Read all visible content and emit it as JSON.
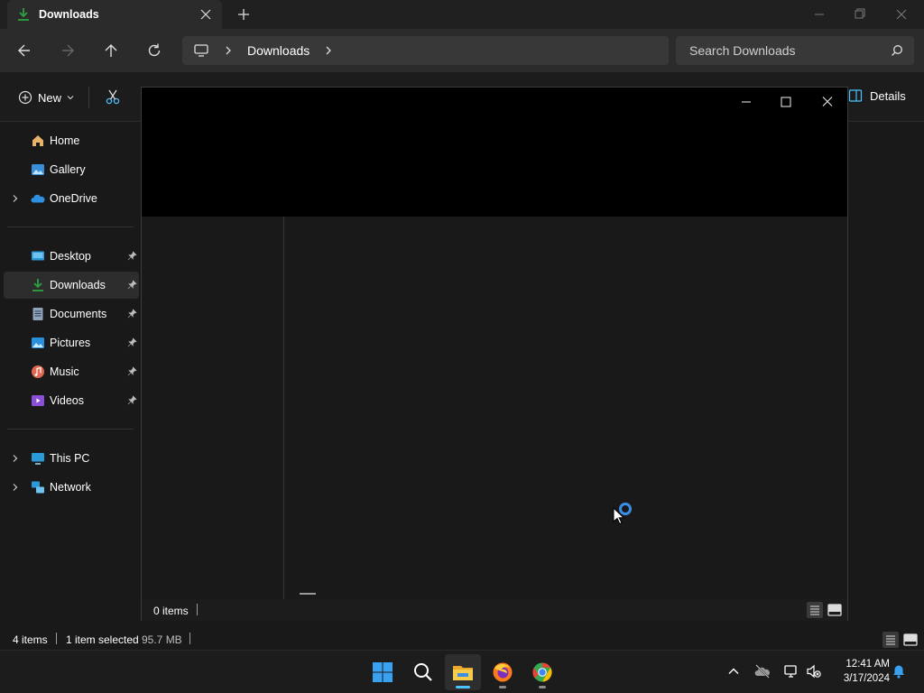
{
  "window": {
    "tab_title": "Downloads",
    "colors": {
      "accent": "#4cc2ff",
      "download_green": "#2ea043",
      "background": "#191919"
    }
  },
  "navbar": {
    "breadcrumb": "Downloads",
    "search_placeholder": "Search Downloads"
  },
  "command_bar": {
    "new_label": "New",
    "details_label": "Details"
  },
  "sidebar": {
    "items": [
      {
        "label": "Home",
        "icon": "home-icon",
        "expandable": false
      },
      {
        "label": "Gallery",
        "icon": "gallery-icon",
        "expandable": false
      },
      {
        "label": "OneDrive",
        "icon": "onedrive-icon",
        "expandable": true
      },
      {
        "label": "Desktop",
        "icon": "desktop-icon",
        "pinned": true
      },
      {
        "label": "Downloads",
        "icon": "downloads-icon",
        "pinned": true,
        "selected": true
      },
      {
        "label": "Documents",
        "icon": "documents-icon",
        "pinned": true
      },
      {
        "label": "Pictures",
        "icon": "pictures-icon",
        "pinned": true
      },
      {
        "label": "Music",
        "icon": "music-icon",
        "pinned": true
      },
      {
        "label": "Videos",
        "icon": "videos-icon",
        "pinned": true
      },
      {
        "label": "This PC",
        "icon": "this-pc-icon",
        "expandable": true
      },
      {
        "label": "Network",
        "icon": "network-icon",
        "expandable": true
      }
    ]
  },
  "status": {
    "item_count": "4 items",
    "selection": "1 item selected",
    "size": "95.7 MB"
  },
  "dialog": {
    "item_count": "0 items"
  },
  "taskbar": {
    "time": "12:41 AM",
    "date": "3/17/2024"
  }
}
